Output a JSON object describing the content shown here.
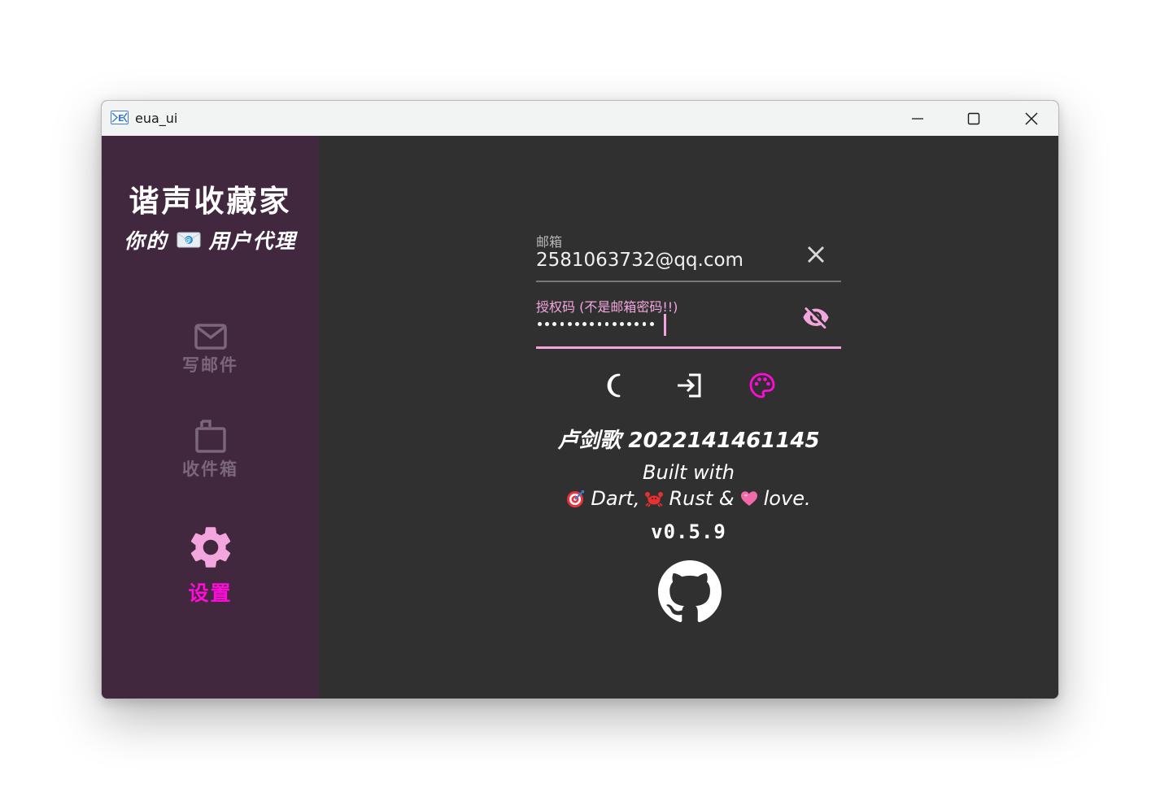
{
  "window": {
    "title": "eua_ui"
  },
  "sidebar": {
    "app_name": "谐声收藏家",
    "tagline_prefix": "你的",
    "tagline_suffix": "用户代理",
    "items": [
      {
        "label": "写邮件",
        "icon": "mail-icon",
        "active": false
      },
      {
        "label": "收件箱",
        "icon": "inbox-icon",
        "active": false
      },
      {
        "label": "设置",
        "icon": "gear-icon",
        "active": true
      }
    ]
  },
  "form": {
    "email": {
      "label": "邮箱",
      "value": "2581063732@qq.com",
      "action_icon": "clear-icon"
    },
    "auth_code": {
      "label": "授权码 (不是邮箱密码!!)",
      "masked_length": 16,
      "action_icon": "visibility-off-icon"
    }
  },
  "actions": [
    {
      "icon": "moon-icon"
    },
    {
      "icon": "login-icon"
    },
    {
      "icon": "palette-icon"
    }
  ],
  "about": {
    "author": "卢剑歌 2022141461145",
    "built_line1": "Built with",
    "dart": "Dart,",
    "rust": "Rust &",
    "love": "love.",
    "version": "v0.5.9"
  },
  "colors": {
    "sidebar_bg": "#42283f",
    "main_bg": "#303030",
    "accent_pink": "#f3a6dd",
    "active_magenta": "#ff0bd9",
    "dim_nav": "#7c6679"
  }
}
